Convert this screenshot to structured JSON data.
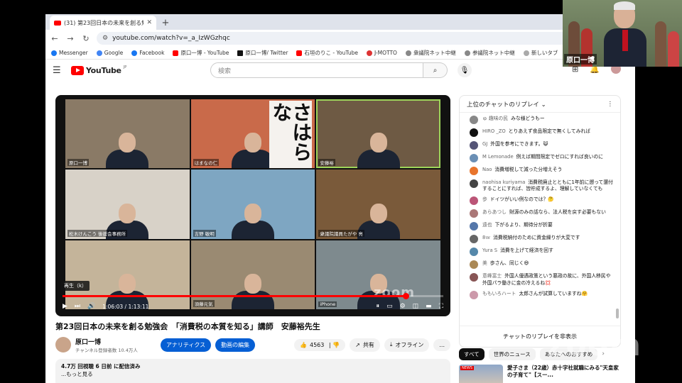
{
  "browser": {
    "tab_title": "(31) 第23回日本の未来を創る勉...",
    "url": "youtube.com/watch?v=_a_IzWGzhqc",
    "bookmarks": [
      "Messenger",
      "Google",
      "Facebook",
      "原口一博 - YouTube",
      "原口一博/ Twitter",
      "石垣のりこ - YouTube",
      "J-MOTTO",
      "衆議院ネット中継",
      "参議院ネット中継",
      "新しいタブ"
    ]
  },
  "yt": {
    "logo": "YouTube",
    "logo_region": "JP",
    "search_placeholder": "検索",
    "notif_count": "9+"
  },
  "player": {
    "tiles": [
      {
        "name": "原口一博",
        "bg": "#8a7a66"
      },
      {
        "name": "はまなの仁",
        "bg": "#c96a4a"
      },
      {
        "name": "安藤裕",
        "bg": "#6e5a44"
      },
      {
        "name": "松木けんこう 後援会事務所",
        "bg": "#d8d2c8"
      },
      {
        "name": "吉野 敏明",
        "bg": "#7ea6c2"
      },
      {
        "name": "衆議院議員たがや 亮",
        "bg": "#7a5a3a"
      },
      {
        "name": "",
        "bg": "#c4b49a"
      },
      {
        "name": "須藤元気",
        "bg": "#9a8a72"
      },
      {
        "name": "iPhone",
        "bg": "#7e8a8e"
      }
    ],
    "tile_text": "さはらな",
    "tooltip": "再生（k）",
    "current_time": "1:06:03",
    "duration": "1:13:11",
    "progress": 0.902,
    "watermark": "zoom"
  },
  "video": {
    "title": "第23回日本の未来を創る勉強会　「消費税の本質を知る」講師　安藤裕先生",
    "channel": "原口一博",
    "subs": "チャンネル登録者数 10.4万人",
    "btn_analytics": "アナリティクス",
    "btn_edit": "動画の編集",
    "likes": "4563",
    "share": "共有",
    "offline": "オフライン",
    "more": "...",
    "views": "4.7万 回視聴  6 日前 に配信済み",
    "show_more": "...もっと見る"
  },
  "chat": {
    "header": "上位のチャットのリプレイ",
    "messages": [
      {
        "author": "ゅ 趣味の民",
        "text": "みな様どうもー",
        "color": "#888"
      },
      {
        "author": "HIRO _ZO",
        "text": "とりあえず食品限定で無くしてみれば",
        "color": "#111"
      },
      {
        "author": "GJ",
        "text": "外国を参考にできます。😺",
        "color": "#557"
      },
      {
        "author": "M Lemonade",
        "text": "例えば期間限定でゼロにすれば良いのに",
        "color": "#6a8fb5"
      },
      {
        "author": "Nao",
        "text": "消費増税して減った分増えそう",
        "color": "#e8742c"
      },
      {
        "author": "naohisa kuriyama",
        "text": "消費税廃止とともに1年前に遡って還付することにすれば、皆貯成するよ、理解していなくても",
        "color": "#444"
      },
      {
        "author": "歩",
        "text": "ドイツがいい例なのでは？🤔",
        "color": "#b57"
      },
      {
        "author": "あらあつし",
        "text": "財源のみの話なら、法人税を戻す必要もない",
        "color": "#a77"
      },
      {
        "author": "遠也",
        "text": "下がるより、期待分が折要",
        "color": "#57a"
      },
      {
        "author": "8ｗ",
        "text": "消費税納付のために資金繰りが大変です",
        "color": "#666"
      },
      {
        "author": "Yura S",
        "text": "消費を上げて経済を回す",
        "color": "#58a"
      },
      {
        "author": "美",
        "text": "歩さん、同じく😄",
        "color": "#a85"
      },
      {
        "author": "意峰富士",
        "text": "外国人優遇政策という悪政の故に、外国人移民や外国パラ働きに金の冷えるね💢",
        "color": "#855"
      },
      {
        "author": "ももいろハート",
        "text": "太郎さんが試算していますね🤗",
        "color": "#c9a"
      }
    ],
    "hide_replay": "チャットのリプレイを非表示"
  },
  "chips": [
    "すべて",
    "世界のニュース",
    "あなたへのおすすめ"
  ],
  "recommend": {
    "thumb_label": "NEWS",
    "title": "愛子さま（22歳）赤十字社就職にみる\"天皇家の子育て\"【スー..."
  },
  "zoom_brand": "zoom",
  "selfview": {
    "name": "原口一博"
  }
}
